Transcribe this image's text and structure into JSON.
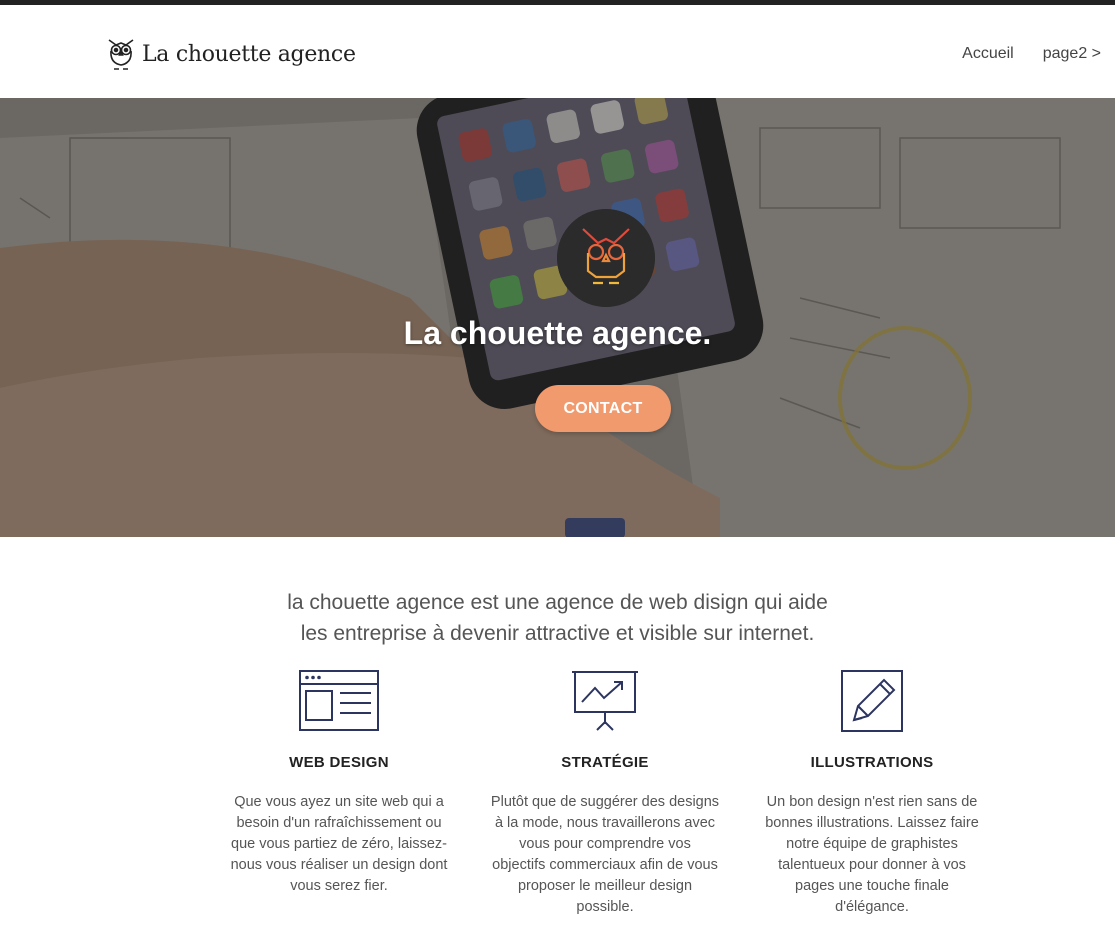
{
  "brand": {
    "name": "La chouette agence",
    "logo_icon": "owl-icon"
  },
  "nav": {
    "items": [
      {
        "label": "Accueil"
      },
      {
        "label": "page2 >"
      }
    ]
  },
  "hero": {
    "title": "La chouette agence.",
    "badge_icon": "owl-logo-icon",
    "cta_label": "CONTACT",
    "cta_color": "#f09a6d"
  },
  "intro": {
    "line1": "la chouette agence est une agence de web disign qui aide",
    "line2": "les entreprise à devenir attractive et visible sur internet."
  },
  "services": [
    {
      "icon": "web-design-icon",
      "title": "WEB DESIGN",
      "lines": [
        "Que vous ayez un site web qui a",
        "besoin d'un rafraîchissement ou",
        "que vous partiez de zéro, laissez-",
        "nous vous réaliser un design dont",
        "vous serez fier."
      ]
    },
    {
      "icon": "strategy-chart-icon",
      "title": "STRATÉGIE",
      "lines": [
        "Plutôt que de suggérer des designs",
        "à la mode, nous travaillerons avec",
        "vous pour comprendre vos",
        "objectifs commerciaux afin de vous",
        "proposer le meilleur design",
        "possible."
      ]
    },
    {
      "icon": "pencil-icon",
      "title": "ILLUSTRATIONS",
      "lines": [
        "Un bon design n'est rien sans de",
        "bonnes illustrations. Laissez faire",
        "notre équipe de graphistes",
        "talentueux pour donner à vos",
        "pages une touche finale",
        "d'élégance."
      ]
    }
  ],
  "colors": {
    "accent": "#f09a6d",
    "icon_navy": "#2c3560",
    "text": "#555555"
  }
}
